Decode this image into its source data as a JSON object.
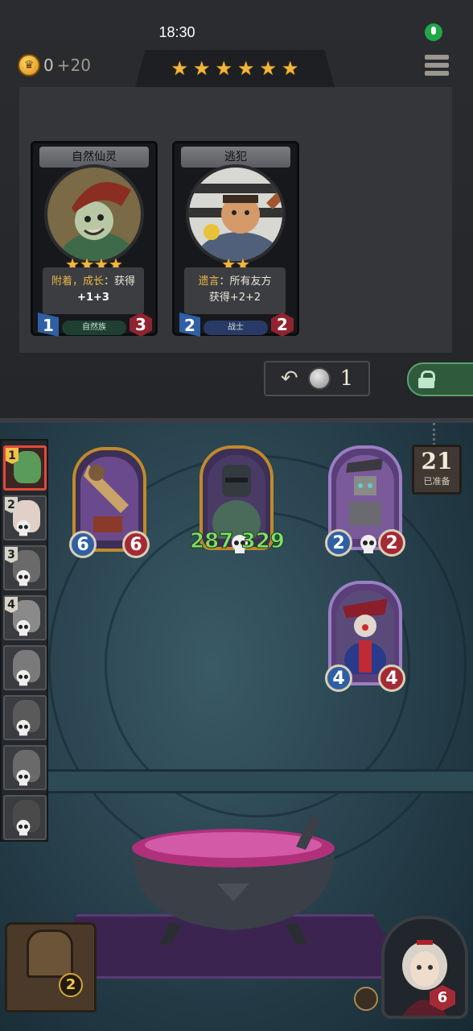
{
  "status_bar": {
    "time": "18:30"
  },
  "header": {
    "gold_value": "0",
    "gold_income": "+20",
    "tavern_tier_stars": 6
  },
  "shop": {
    "cards": [
      {
        "name": "自然仙灵",
        "stars": 4,
        "description_keywords": "附着，成长",
        "description_rest": "：获得",
        "description_line2": "+1+3",
        "tribe": "自然族",
        "attack": "1",
        "health": "3"
      },
      {
        "name": "逃犯",
        "stars": 2,
        "description_keywords": "遗言",
        "description_rest": "：所有友方",
        "description_line2": "获得+2+2",
        "tribe": "战士",
        "attack": "2",
        "health": "2"
      }
    ],
    "refresh_cost": "1"
  },
  "board": {
    "ready_count": "21",
    "ready_label": "已准备",
    "rail_slots": [
      {
        "number": "1",
        "active": true
      },
      {
        "number": "2",
        "active": false
      },
      {
        "number": "3",
        "active": false
      },
      {
        "number": "4",
        "active": false
      },
      {
        "number": "",
        "active": false
      },
      {
        "number": "",
        "active": false
      },
      {
        "number": "",
        "active": false
      },
      {
        "number": "",
        "active": false
      }
    ],
    "minions": [
      {
        "attack": "6",
        "health": "6"
      },
      {
        "attack": "287",
        "health": "329"
      },
      {
        "attack": "2",
        "health": "2"
      },
      {
        "attack": "4",
        "health": "4"
      }
    ]
  },
  "footer": {
    "discard_count": "2",
    "hero_health": "6"
  },
  "colors": {
    "gold_star": "#f2b63c",
    "attack_blue": "#2f5fa5",
    "health_red": "#a42a35",
    "buffed_green": "#7fe06a",
    "active_slot_border": "#e04a3a"
  }
}
